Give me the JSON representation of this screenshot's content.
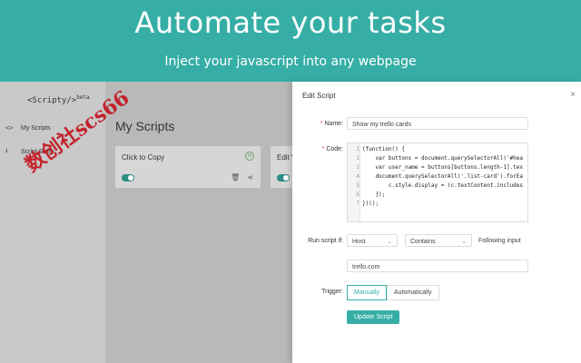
{
  "banner": {
    "title": "Automate your tasks",
    "subtitle": "Inject your javascript into any webpage"
  },
  "sidebar": {
    "brand": "<Scripty/>",
    "brand_sup": "beta",
    "items": [
      {
        "label": "My Scripts",
        "icon": "code-icon",
        "glyph": "<>"
      },
      {
        "label": "Script Store",
        "icon": "download-icon",
        "glyph": "⭳"
      }
    ]
  },
  "main": {
    "title": "My Scripts",
    "cards": [
      {
        "title": "Click to Copy",
        "enabled": true
      },
      {
        "title": "Edit W",
        "enabled": true
      }
    ]
  },
  "watermark": "数创社scs66",
  "panel": {
    "title": "Edit Script",
    "name_label": "Name:",
    "name_value": "Show my trello cards",
    "code_label": "Code:",
    "code_lines": [
      {
        "no": "1",
        "text": "(function() {"
      },
      {
        "no": "2",
        "text": "    var buttons = document.querySelectorAll('#hea"
      },
      {
        "no": "3",
        "text": "    var user_name = buttons[buttons.length-1].tex"
      },
      {
        "no": "4",
        "text": "    document.querySelectorAll('.list-card').forEa"
      },
      {
        "no": "5",
        "text": "        c.style.display = (c.textContent.includes"
      },
      {
        "no": "6",
        "text": "    });"
      },
      {
        "no": "7",
        "text": "})();"
      }
    ],
    "run_label": "Run script if:",
    "condition_field": "Host",
    "condition_operator": "Contains",
    "following_input": "Following input",
    "condition_value": "trello.com",
    "trigger_label": "Trigger:",
    "trigger_options": [
      "Manually",
      "Automatically"
    ],
    "trigger_selected": "Manually",
    "submit_label": "Update Script"
  },
  "colors": {
    "accent": "#36aea6",
    "required": "#e0453a"
  }
}
